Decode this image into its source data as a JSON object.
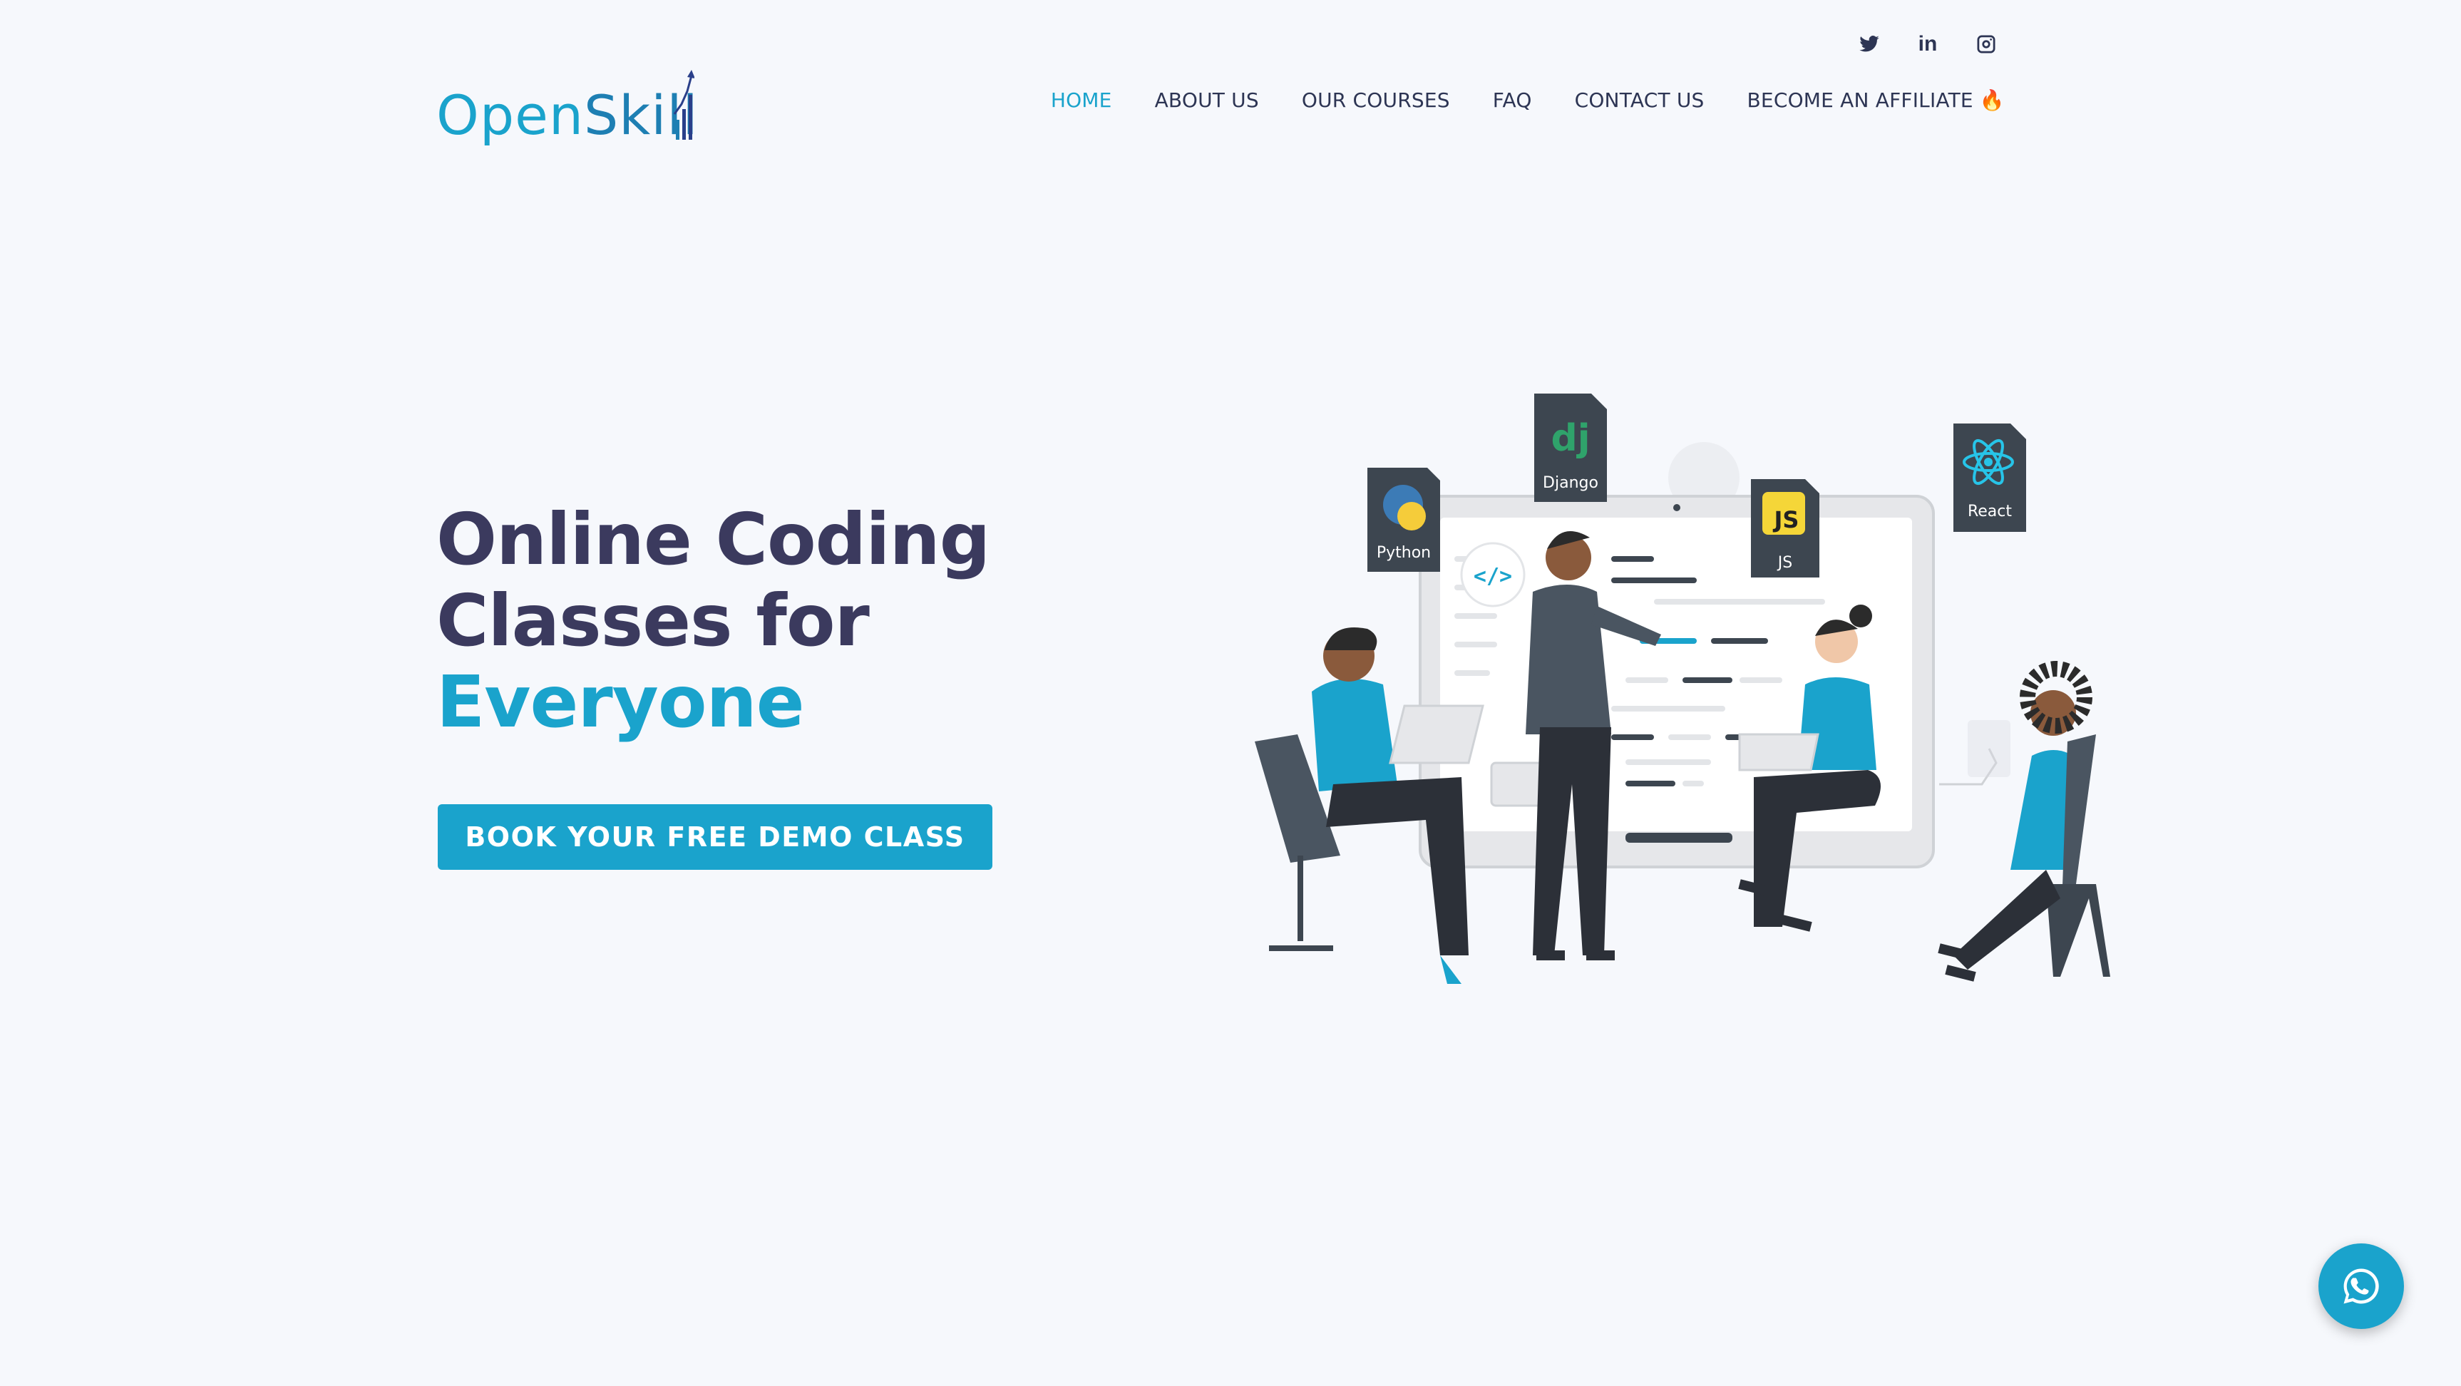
{
  "brand": {
    "logo_open": "Open",
    "logo_skill": "Skill",
    "color_primary": "#1aa3cc",
    "color_dark": "#3b3a5e"
  },
  "social": [
    {
      "icon": "twitter-icon"
    },
    {
      "icon": "linkedin-icon",
      "label": "in"
    },
    {
      "icon": "instagram-icon"
    }
  ],
  "nav": {
    "items": [
      {
        "label": "HOME",
        "active": true
      },
      {
        "label": "ABOUT US"
      },
      {
        "label": "OUR COURSES"
      },
      {
        "label": "FAQ"
      },
      {
        "label": "CONTACT US"
      },
      {
        "label": "BECOME AN AFFILIATE"
      }
    ],
    "affiliate_emoji": "🔥"
  },
  "hero": {
    "line1": "Online Coding",
    "line2": "Classes for",
    "line3": "Everyone",
    "cta": "BOOK YOUR FREE DEMO CLASS"
  },
  "illustration": {
    "badges": {
      "python": "Python",
      "django": "Django",
      "django_logo": "dj",
      "js": "JS",
      "js_logo": "JS",
      "react": "React"
    },
    "code_tag": "</>"
  },
  "whatsapp": {
    "icon": "whatsapp-icon"
  }
}
